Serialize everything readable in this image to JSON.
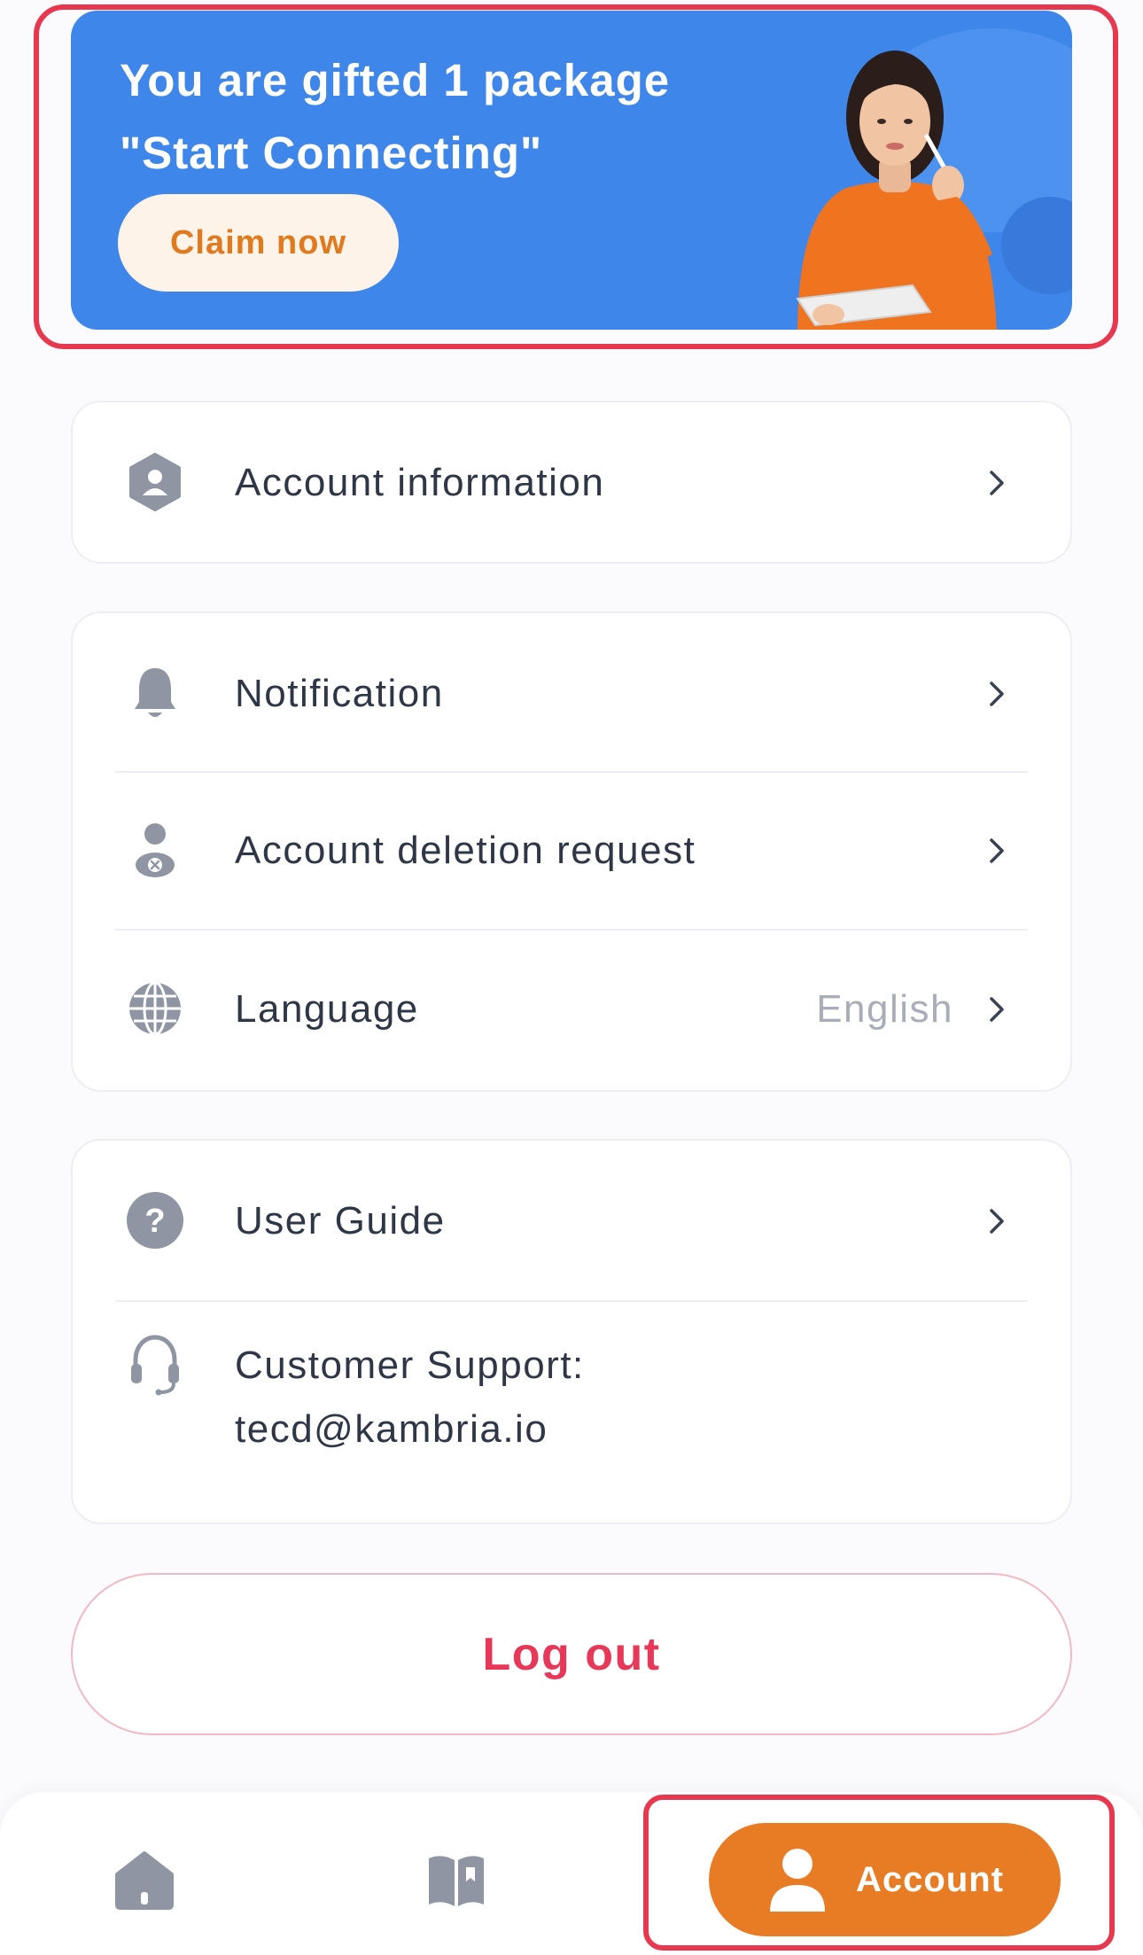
{
  "banner": {
    "title_line1": "You are gifted 1 package",
    "title_line2": "\"Start Connecting\"",
    "cta_label": "Claim now",
    "bg_color": "#3e86ea",
    "cta_text_color": "#e07a1f"
  },
  "menu": {
    "account_information": {
      "label": "Account information",
      "icon": "user-shield-icon"
    },
    "notification": {
      "label": "Notification",
      "icon": "bell-icon"
    },
    "account_deletion": {
      "label": "Account deletion request",
      "icon": "user-remove-icon"
    },
    "language": {
      "label": "Language",
      "value": "English",
      "icon": "globe-icon"
    },
    "user_guide": {
      "label": "User Guide",
      "icon": "question-circle-icon"
    },
    "customer_support": {
      "label_line1": "Customer Support:",
      "label_line2": "tecd@kambria.io",
      "icon": "headset-icon"
    }
  },
  "logout": {
    "label": "Log out",
    "color": "#e8385a"
  },
  "bottom_nav": {
    "items": [
      {
        "name": "home",
        "icon": "home-icon"
      },
      {
        "name": "guide",
        "icon": "book-icon"
      },
      {
        "name": "account",
        "icon": "user-icon",
        "label": "Account",
        "active": true
      }
    ],
    "active_color": "#e87c25"
  }
}
